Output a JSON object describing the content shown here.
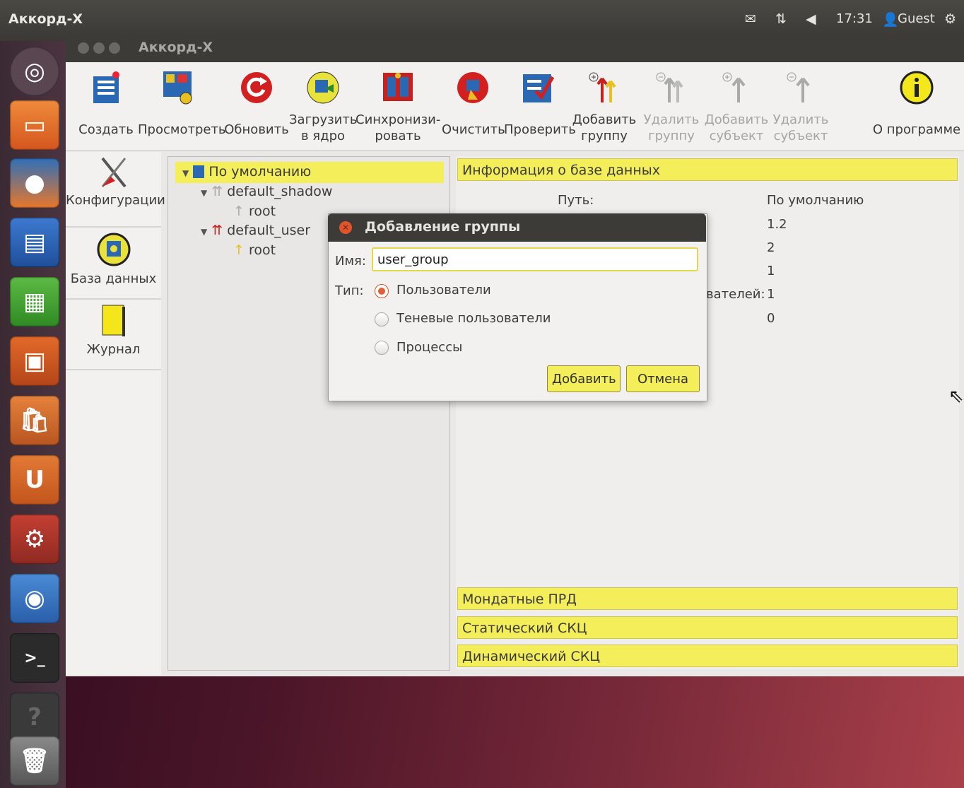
{
  "panel": {
    "app_name": "Аккорд-Х",
    "mail_icon": "envelope-icon",
    "network_icon": "network-icon",
    "sound_icon": "speaker-icon",
    "clock": "17:31",
    "user": "Guest",
    "power_icon": "gear-icon"
  },
  "launcher": [
    "dash-icon",
    "files-icon",
    "firefox-icon",
    "writer-icon",
    "calc-icon",
    "impress-icon",
    "software-center-icon",
    "ubuntu-one-icon",
    "system-settings-icon",
    "chromium-icon",
    "terminal-icon",
    "help-icon",
    "trash-icon"
  ],
  "window": {
    "title": "Аккорд-Х"
  },
  "toolbar": {
    "create": "Создать",
    "view": "Просмотреть",
    "refresh": "Обновить",
    "load_line1": "Загрузить",
    "load_line2": "в ядро",
    "sync_line1": "Синхронизи-",
    "sync_line2": "ровать",
    "clear": "Очистить",
    "check": "Проверить",
    "add_group_line1": "Добавить",
    "add_group_line2": "группу",
    "del_group_line1": "Удалить",
    "del_group_line2": "группу",
    "add_subj_line1": "Добавить",
    "add_subj_line2": "субъект",
    "del_subj_line1": "Удалить",
    "del_subj_line2": "субъект",
    "about": "О программе"
  },
  "nav": {
    "config": "Конфигурации",
    "database": "База данных",
    "journal": "Журнал"
  },
  "tree": {
    "root": "По умолчанию",
    "shadow": "default_shadow",
    "shadow_child": "root",
    "user": "default_user",
    "user_child": "root"
  },
  "info": {
    "header": "Информация о базе данных",
    "path_label": "Путь:",
    "path_value": "По умолчанию",
    "v1": "1.2",
    "v2": "2",
    "v3": "1",
    "users_label_partial": "вателей:",
    "v4": "1",
    "v5": "0"
  },
  "sections": {
    "mandate": "Мондатные ПРД",
    "static": "Статический СКЦ",
    "dynamic": "Динамический СКЦ"
  },
  "dialog": {
    "title": "Добавление группы",
    "name_label": "Имя:",
    "name_value": "user_group",
    "type_label": "Тип:",
    "opt_users": "Пользователи",
    "opt_shadow": "Теневые пользователи",
    "opt_process": "Процессы",
    "selected": "Пользователи",
    "add": "Добавить",
    "cancel": "Отмена"
  },
  "colors": {
    "accent_yellow": "#f4ee5a",
    "panel_dark": "#3c3b37",
    "radio_orange": "#e06037"
  }
}
